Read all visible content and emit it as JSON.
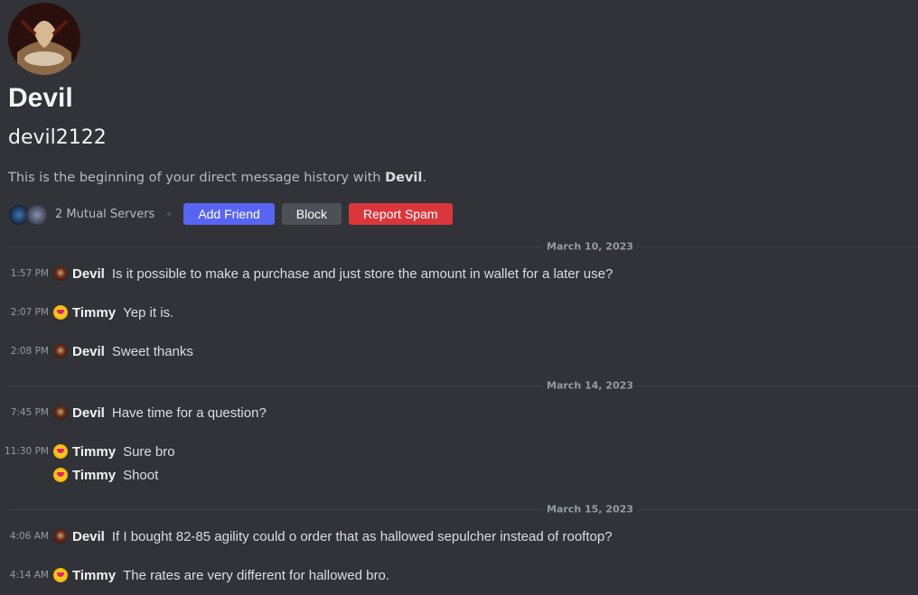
{
  "profile": {
    "display_name": "Devil",
    "username": "devil2122",
    "intro_prefix": "This is the beginning of your direct message history with ",
    "intro_name": "Devil",
    "intro_suffix": "."
  },
  "actions": {
    "mutual_servers": "2 Mutual Servers",
    "add_friend": "Add Friend",
    "block": "Block",
    "report_spam": "Report Spam"
  },
  "dividers": [
    "March 10, 2023",
    "March 14, 2023",
    "March 15, 2023"
  ],
  "messages": [
    {
      "time": "1:57 PM",
      "author": "Devil",
      "text": "Is it possible to make a purchase and just store the amount in wallet for a later use?"
    },
    {
      "time": "2:07 PM",
      "author": "Timmy",
      "text": "Yep it is."
    },
    {
      "time": "2:08 PM",
      "author": "Devil",
      "text": "Sweet thanks"
    },
    {
      "time": "7:45 PM",
      "author": "Devil",
      "text": "Have time for a question?"
    },
    {
      "time": "11:30 PM",
      "author": "Timmy",
      "text": "Sure bro"
    },
    {
      "time": "",
      "author": "Timmy",
      "text": "Shoot"
    },
    {
      "time": "4:06 AM",
      "author": "Devil",
      "text": "If I bought 82-85 agility could o order that as hallowed sepulcher instead of rooftop?"
    },
    {
      "time": "4:14 AM",
      "author": "Timmy",
      "text": "The rates are very different for hallowed bro."
    }
  ],
  "colors": {
    "background": "#313338",
    "add_friend": "#5865f2",
    "block": "#4e5058",
    "report_spam": "#da373c"
  }
}
